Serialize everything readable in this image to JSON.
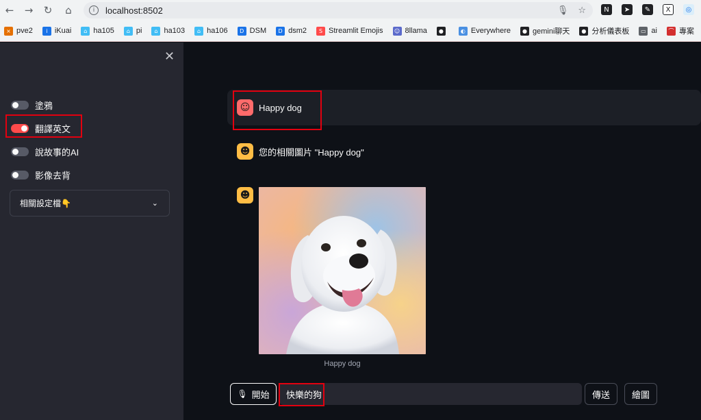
{
  "browser": {
    "url": "localhost:8502",
    "nav_icons": [
      "back-icon",
      "forward-icon",
      "reload-icon",
      "home-icon"
    ],
    "bookmarks": [
      {
        "label": "pve2",
        "color": "#e57000"
      },
      {
        "label": "iKuai",
        "color": "#1a73e8"
      },
      {
        "label": "ha105",
        "color": "#41bdf5"
      },
      {
        "label": "pi",
        "color": "#41bdf5"
      },
      {
        "label": "ha103",
        "color": "#41bdf5"
      },
      {
        "label": "ha106",
        "color": "#41bdf5"
      },
      {
        "label": "DSM",
        "color": "#1a73e8"
      },
      {
        "label": "dsm2",
        "color": "#1a73e8"
      },
      {
        "label": "Streamlit Emojis",
        "color": "#ff4b4b"
      },
      {
        "label": "8llama",
        "color": "#5b6acb"
      },
      {
        "label": "",
        "color": "#202124"
      },
      {
        "label": "Everywhere",
        "color": "#4a90e2"
      },
      {
        "label": "gemini聊天",
        "color": "#202124"
      },
      {
        "label": "分析儀表板",
        "color": "#202124"
      },
      {
        "label": "ai",
        "color": "#5f6368"
      },
      {
        "label": "專案",
        "color": "#d32f2f"
      }
    ]
  },
  "sidebar": {
    "toggles": [
      {
        "label": "塗鴉",
        "on": false
      },
      {
        "label": "翻譯英文",
        "on": true
      },
      {
        "label": "說故事的AI",
        "on": false
      },
      {
        "label": "影像去背",
        "on": false
      }
    ],
    "expander_label": "相關設定檔👇"
  },
  "chat": {
    "user_message": "Happy dog",
    "assistant_message": "您的相關圖片 \"Happy dog\"",
    "image_caption": "Happy dog"
  },
  "input": {
    "start_label": "開始",
    "value": "快樂的狗",
    "send_label": "傳送",
    "draw_label": "繪圖"
  },
  "colors": {
    "accent": "#ff4b4b",
    "sidebar_bg": "#262730",
    "main_bg": "#0e1117",
    "highlight": "#e3000f"
  }
}
